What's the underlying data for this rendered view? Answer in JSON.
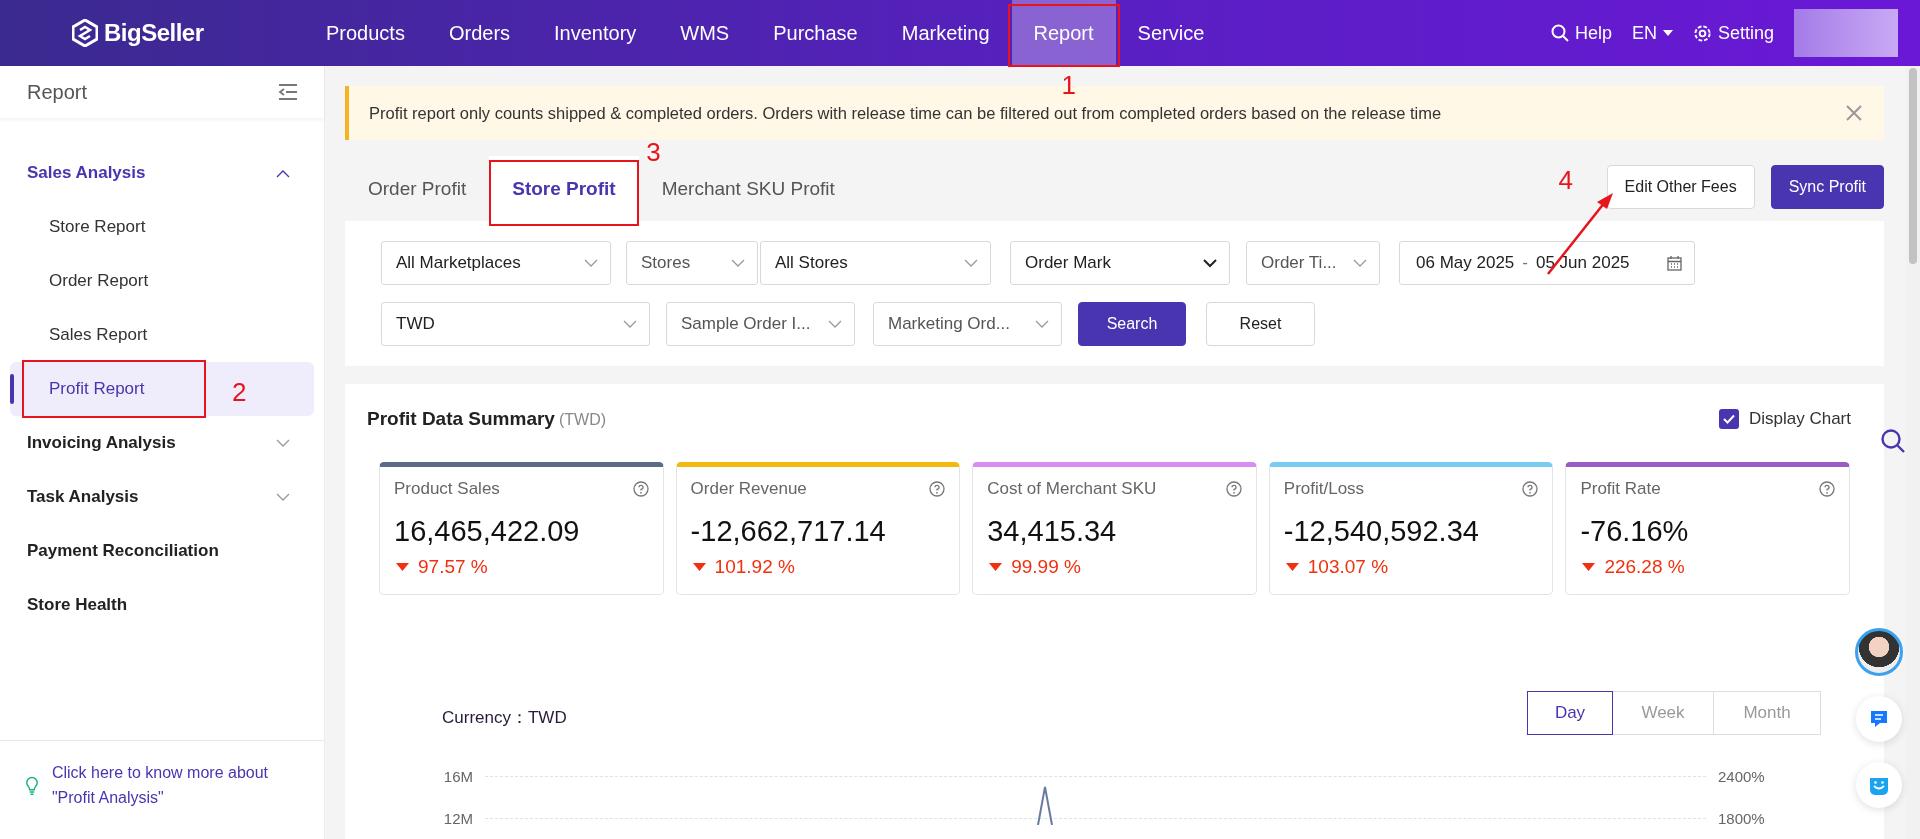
{
  "nav": {
    "brand": "BigSeller",
    "items": [
      {
        "label": "Products",
        "selected": false
      },
      {
        "label": "Orders",
        "selected": false
      },
      {
        "label": "Inventory",
        "selected": false
      },
      {
        "label": "WMS",
        "selected": false
      },
      {
        "label": "Purchase",
        "selected": false
      },
      {
        "label": "Marketing",
        "selected": false
      },
      {
        "label": "Report",
        "selected": true,
        "annotation": "1"
      },
      {
        "label": "Service",
        "selected": false
      }
    ],
    "help": "Help",
    "language": "EN",
    "setting": "Setting"
  },
  "sidebar": {
    "title": "Report",
    "items": [
      {
        "kind": "group",
        "label": "Sales Analysis",
        "expanded": true,
        "children": [
          {
            "label": "Store Report",
            "selected": false
          },
          {
            "label": "Order Report",
            "selected": false
          },
          {
            "label": "Sales Report",
            "selected": false
          },
          {
            "label": "Profit Report",
            "selected": true,
            "annotation": "2"
          }
        ]
      },
      {
        "kind": "group",
        "label": "Invoicing Analysis",
        "expanded": false
      },
      {
        "kind": "group",
        "label": "Task Analysis",
        "expanded": false
      },
      {
        "kind": "link",
        "label": "Payment Reconciliation"
      },
      {
        "kind": "link",
        "label": "Store Health"
      }
    ],
    "help_link": "Click here to know more about \"Profit Analysis\""
  },
  "alert": "Profit report only counts shipped & completed orders. Orders with release time can be filtered out from completed orders based on the release time",
  "tabs": [
    {
      "label": "Order Profit",
      "selected": false
    },
    {
      "label": "Store Profit",
      "selected": true,
      "annotation": "3"
    },
    {
      "label": "Merchant SKU Profit",
      "selected": false
    }
  ],
  "actions": [
    {
      "kind": "secondary",
      "label": "Edit Other Fees",
      "annotation": "4"
    },
    {
      "kind": "primary",
      "label": "Sync Profit"
    }
  ],
  "filters": [
    [
      {
        "kind": "select",
        "value": "All Marketplaces"
      },
      {
        "kind": "label-select",
        "value": "Stores"
      },
      {
        "kind": "select",
        "value": "All Stores"
      },
      {
        "kind": "native-select",
        "value": "Order Mark"
      },
      {
        "kind": "label-select",
        "value": "Order Ti..."
      },
      {
        "kind": "date-range",
        "start": "06 May 2025",
        "separator": "-",
        "end": "05 Jun 2025"
      }
    ],
    [
      {
        "kind": "select",
        "value": "TWD"
      },
      {
        "kind": "label-select",
        "value": "Sample Order I..."
      },
      {
        "kind": "label-select",
        "value": "Marketing Ord..."
      },
      {
        "kind": "primary-button",
        "value": "Search"
      },
      {
        "kind": "button",
        "value": "Reset"
      }
    ]
  ],
  "summary": {
    "title": "Profit Data Summary",
    "unit": "(TWD)",
    "display_chart": {
      "label": "Display Chart",
      "checked": true
    },
    "cards": [
      {
        "label": "Product Sales",
        "value": "16,465,422.09",
        "change": "97.57 %",
        "color": "#5c6b8a"
      },
      {
        "label": "Order Revenue",
        "value": "-12,662,717.14",
        "change": "101.92 %",
        "color": "#f2b90f"
      },
      {
        "label": "Cost of Merchant SKU",
        "value": "34,415.34",
        "change": "99.99 %",
        "color": "#d98cf2"
      },
      {
        "label": "Profit/Loss",
        "value": "-12,540,592.34",
        "change": "103.07 %",
        "color": "#79cbf2"
      },
      {
        "label": "Profit Rate",
        "value": "-76.16%",
        "change": "226.28 %",
        "color": "#9a5cc4"
      }
    ]
  },
  "chart": {
    "currency": "Currency：TWD",
    "periods": [
      {
        "label": "Day",
        "selected": true
      },
      {
        "label": "Week",
        "selected": false
      },
      {
        "label": "Month",
        "selected": false
      }
    ],
    "left_ticks": [
      "16M",
      "12M"
    ],
    "right_ticks": [
      "2400%",
      "1800%"
    ]
  }
}
